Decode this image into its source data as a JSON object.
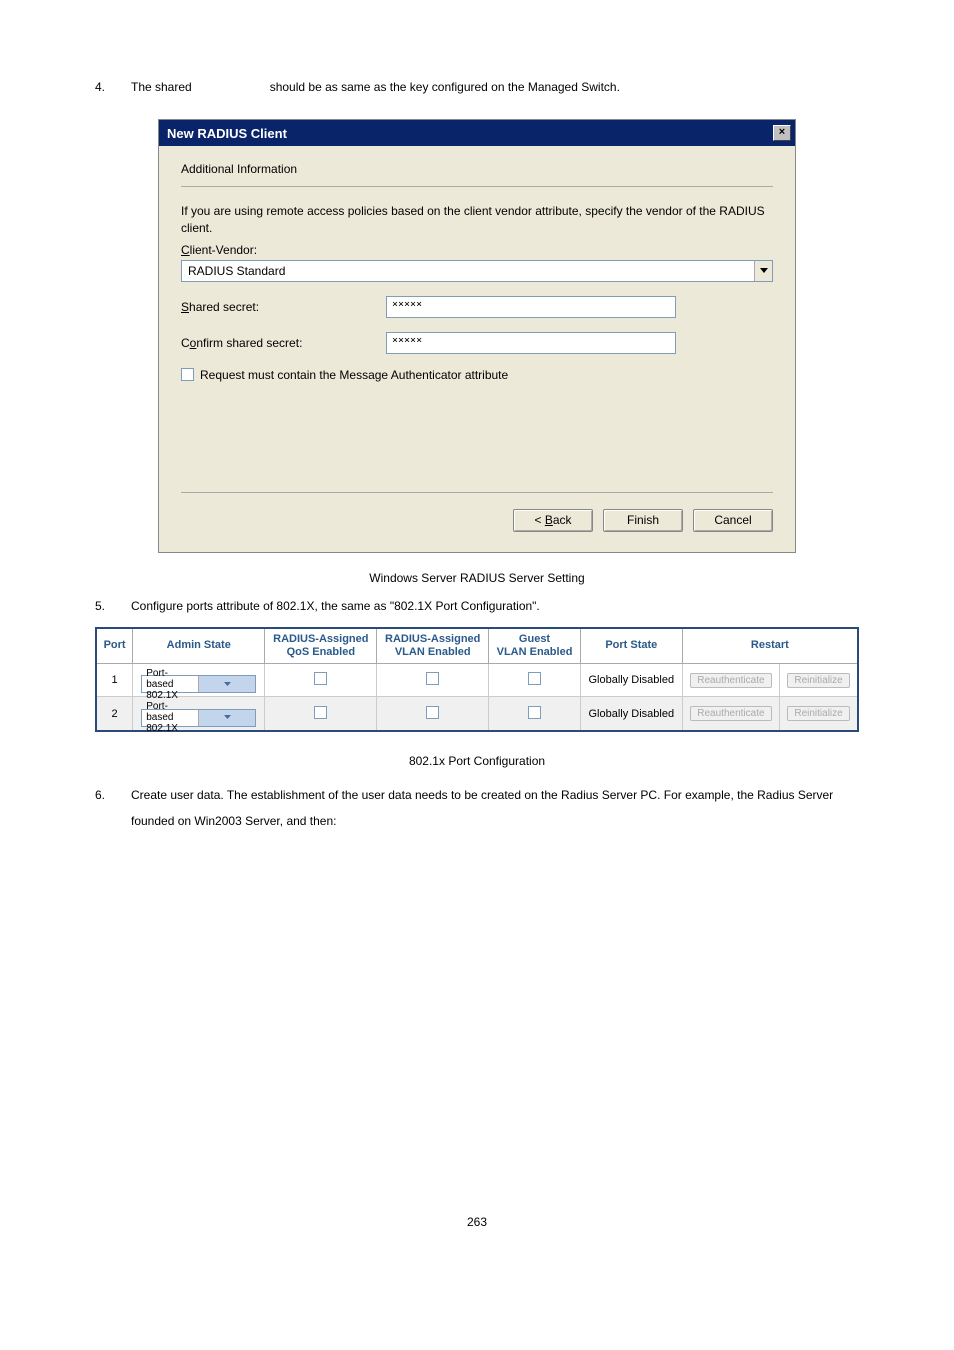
{
  "step4": {
    "num": "4.",
    "textA": "The shared",
    "textB": "should be as same as the key configured on the Managed Switch."
  },
  "dialog": {
    "title": "New RADIUS Client",
    "heading": "Additional Information",
    "desc": "If you are using remote access policies based on the client vendor attribute, specify the vendor of the RADIUS client.",
    "clientVendorLabelPrefix": "C",
    "clientVendorLabelRest": "lient-Vendor:",
    "clientVendorValue": "RADIUS Standard",
    "sharedSecretPrefix": "S",
    "sharedSecretRest": "hared secret:",
    "sharedSecretValue": "×××××",
    "confirmPrefix": "o",
    "confirmRest": "nfirm shared secret:",
    "confirmPrefixC": "C",
    "confirmValue": "×××××",
    "checkPrefix": "R",
    "checkRest": "equest must contain the Message Authenticator attribute",
    "back": "< Back",
    "backUnderline": "B",
    "finish": "Finish",
    "cancel": "Cancel"
  },
  "caption1": "Windows Server RADIUS Server Setting",
  "step5": {
    "num": "5.",
    "text": "Configure ports attribute of 802.1X, the same as \"802.1X Port Configuration\"."
  },
  "table": {
    "headers": {
      "port": "Port",
      "admin": "Admin State",
      "qos": "RADIUS-Assigned\nQoS Enabled",
      "vlan": "RADIUS-Assigned\nVLAN Enabled",
      "guest": "Guest\nVLAN Enabled",
      "state": "Port State",
      "restart": "Restart"
    },
    "rows": [
      {
        "port": "1",
        "admin": "Port-based 802.1X",
        "state": "Globally Disabled",
        "b1": "Reauthenticate",
        "b2": "Reinitialize"
      },
      {
        "port": "2",
        "admin": "Port-based 802.1X",
        "state": "Globally Disabled",
        "b1": "Reauthenticate",
        "b2": "Reinitialize"
      }
    ]
  },
  "caption2": "802.1x Port Configuration",
  "step6": {
    "num": "6.",
    "text": "Create user data. The establishment of the user data needs to be created on the Radius Server PC. For example, the Radius Server founded on Win2003 Server, and then:"
  },
  "pageNum": "263"
}
